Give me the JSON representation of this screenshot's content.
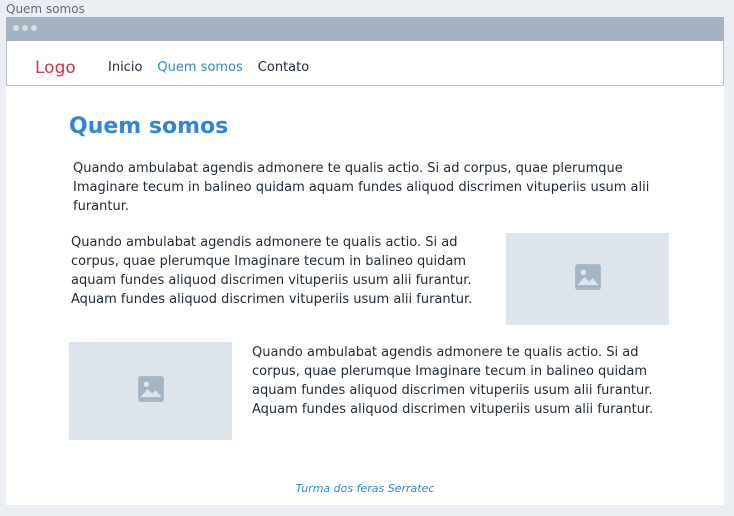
{
  "frame_title": "Quem somos",
  "navbar": {
    "logo": "Logo",
    "links": [
      {
        "label": "Inicio",
        "active": false
      },
      {
        "label": "Quem somos",
        "active": true
      },
      {
        "label": "Contato",
        "active": false
      }
    ]
  },
  "main": {
    "heading": "Quem somos",
    "paragraph1": "Quando ambulabat agendis admonere te qualis actio. Si ad corpus, quae plerumque Imaginare tecum in balineo quidam aquam fundes aliquod discrimen vituperiis usum alii furantur.",
    "paragraph2": "Quando ambulabat agendis admonere te qualis actio. Si ad corpus, quae plerumque Imaginare tecum in balineo quidam aquam fundes aliquod discrimen vituperiis usum alii furantur. Aquam fundes aliquod discrimen vituperiis usum alii furantur.",
    "paragraph3": "Quando ambulabat agendis admonere te qualis actio. Si ad corpus, quae plerumque Imaginare tecum in balineo quidam aquam fundes aliquod discrimen vituperiis usum alii furantur. Aquam fundes aliquod discrimen vituperiis usum alii furantur."
  },
  "icons": [
    "image-placeholder-icon",
    "image-placeholder-icon"
  ],
  "footer": "Turma dos feras Serratec",
  "colors": {
    "accent": "#2f86d6",
    "logo": "#d6344f",
    "placeholder": "#dde4ec"
  }
}
